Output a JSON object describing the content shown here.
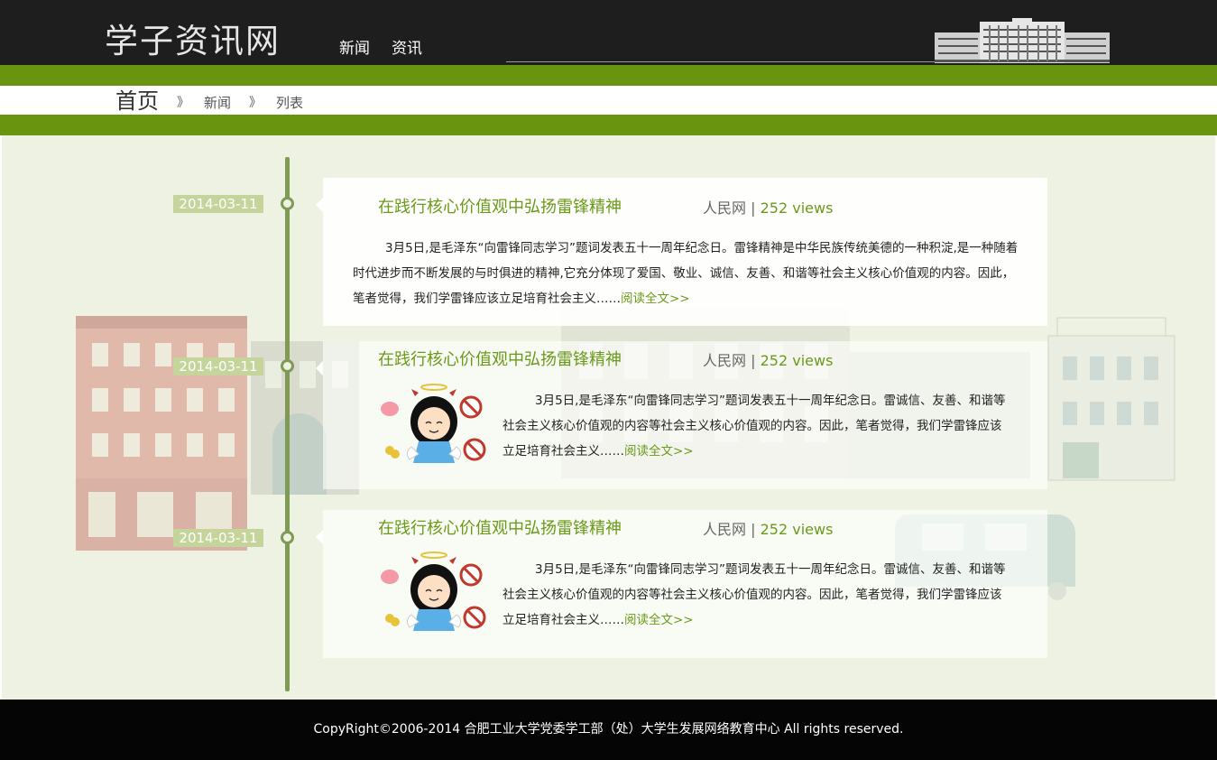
{
  "site": {
    "logo": "学子资讯网"
  },
  "nav": [
    {
      "label": "新闻"
    },
    {
      "label": "资讯"
    }
  ],
  "breadcrumb": {
    "home": "首页",
    "separator": "》",
    "items": [
      {
        "label": "新闻"
      },
      {
        "label": "列表"
      }
    ]
  },
  "posts": [
    {
      "date": "2014-03-11",
      "title": "在践行核心价值观中弘扬雷锋精神",
      "source": "人民网",
      "divider": "|",
      "views": "252 views",
      "excerpt": "3月5日,是毛泽东“向雷锋同志学习”题词发表五十一周年纪念日。雷锋精神是中华民族传统美德的一种积淀,是一种随着时代进步而不断发展的与时俱进的精神,它充分体现了爱国、敬业、诚信、友善、和谐等社会主义核心价值观的内容。因此，笔者觉得，我们学雷锋应该立足培育社会主义……",
      "read_more": "阅读全文>>",
      "has_image": false
    },
    {
      "date": "2014-03-11",
      "title": "在践行核心价值观中弘扬雷锋精神",
      "source": "人民网",
      "divider": "|",
      "views": "252 views",
      "excerpt": "3月5日,是毛泽东“向雷锋同志学习”题词发表五十一周年纪念日。雷诚信、友善、和谐等社会主义核心价值观的内容等社会主义核心价值观的内容。因此，笔者觉得，我们学雷锋应该立足培育社会主义……",
      "read_more": "阅读全文>>",
      "has_image": true
    },
    {
      "date": "2014-03-11",
      "title": "在践行核心价值观中弘扬雷锋精神",
      "source": "人民网",
      "divider": "|",
      "views": "252 views",
      "excerpt": "3月5日,是毛泽东“向雷锋同志学习”题词发表五十一周年纪念日。雷诚信、友善、和谐等社会主义核心价值观的内容等社会主义核心价值观的内容。因此，笔者觉得，我们学雷锋应该立足培育社会主义……",
      "read_more": "阅读全文>>",
      "has_image": true
    }
  ],
  "footer": {
    "copyright": "CopyRight©2006-2014 合肥工业大学党委学工部（处）大学生发展网络教育中心 All rights reserved."
  },
  "colors": {
    "brand_green": "#68940f",
    "header_bg": "#1e1e1e",
    "content_bg": "#edf2e3",
    "link_green": "#6a9a1a"
  },
  "icons": [
    "campus-building-logo-icon",
    "angel-devil-girl-illustration"
  ]
}
